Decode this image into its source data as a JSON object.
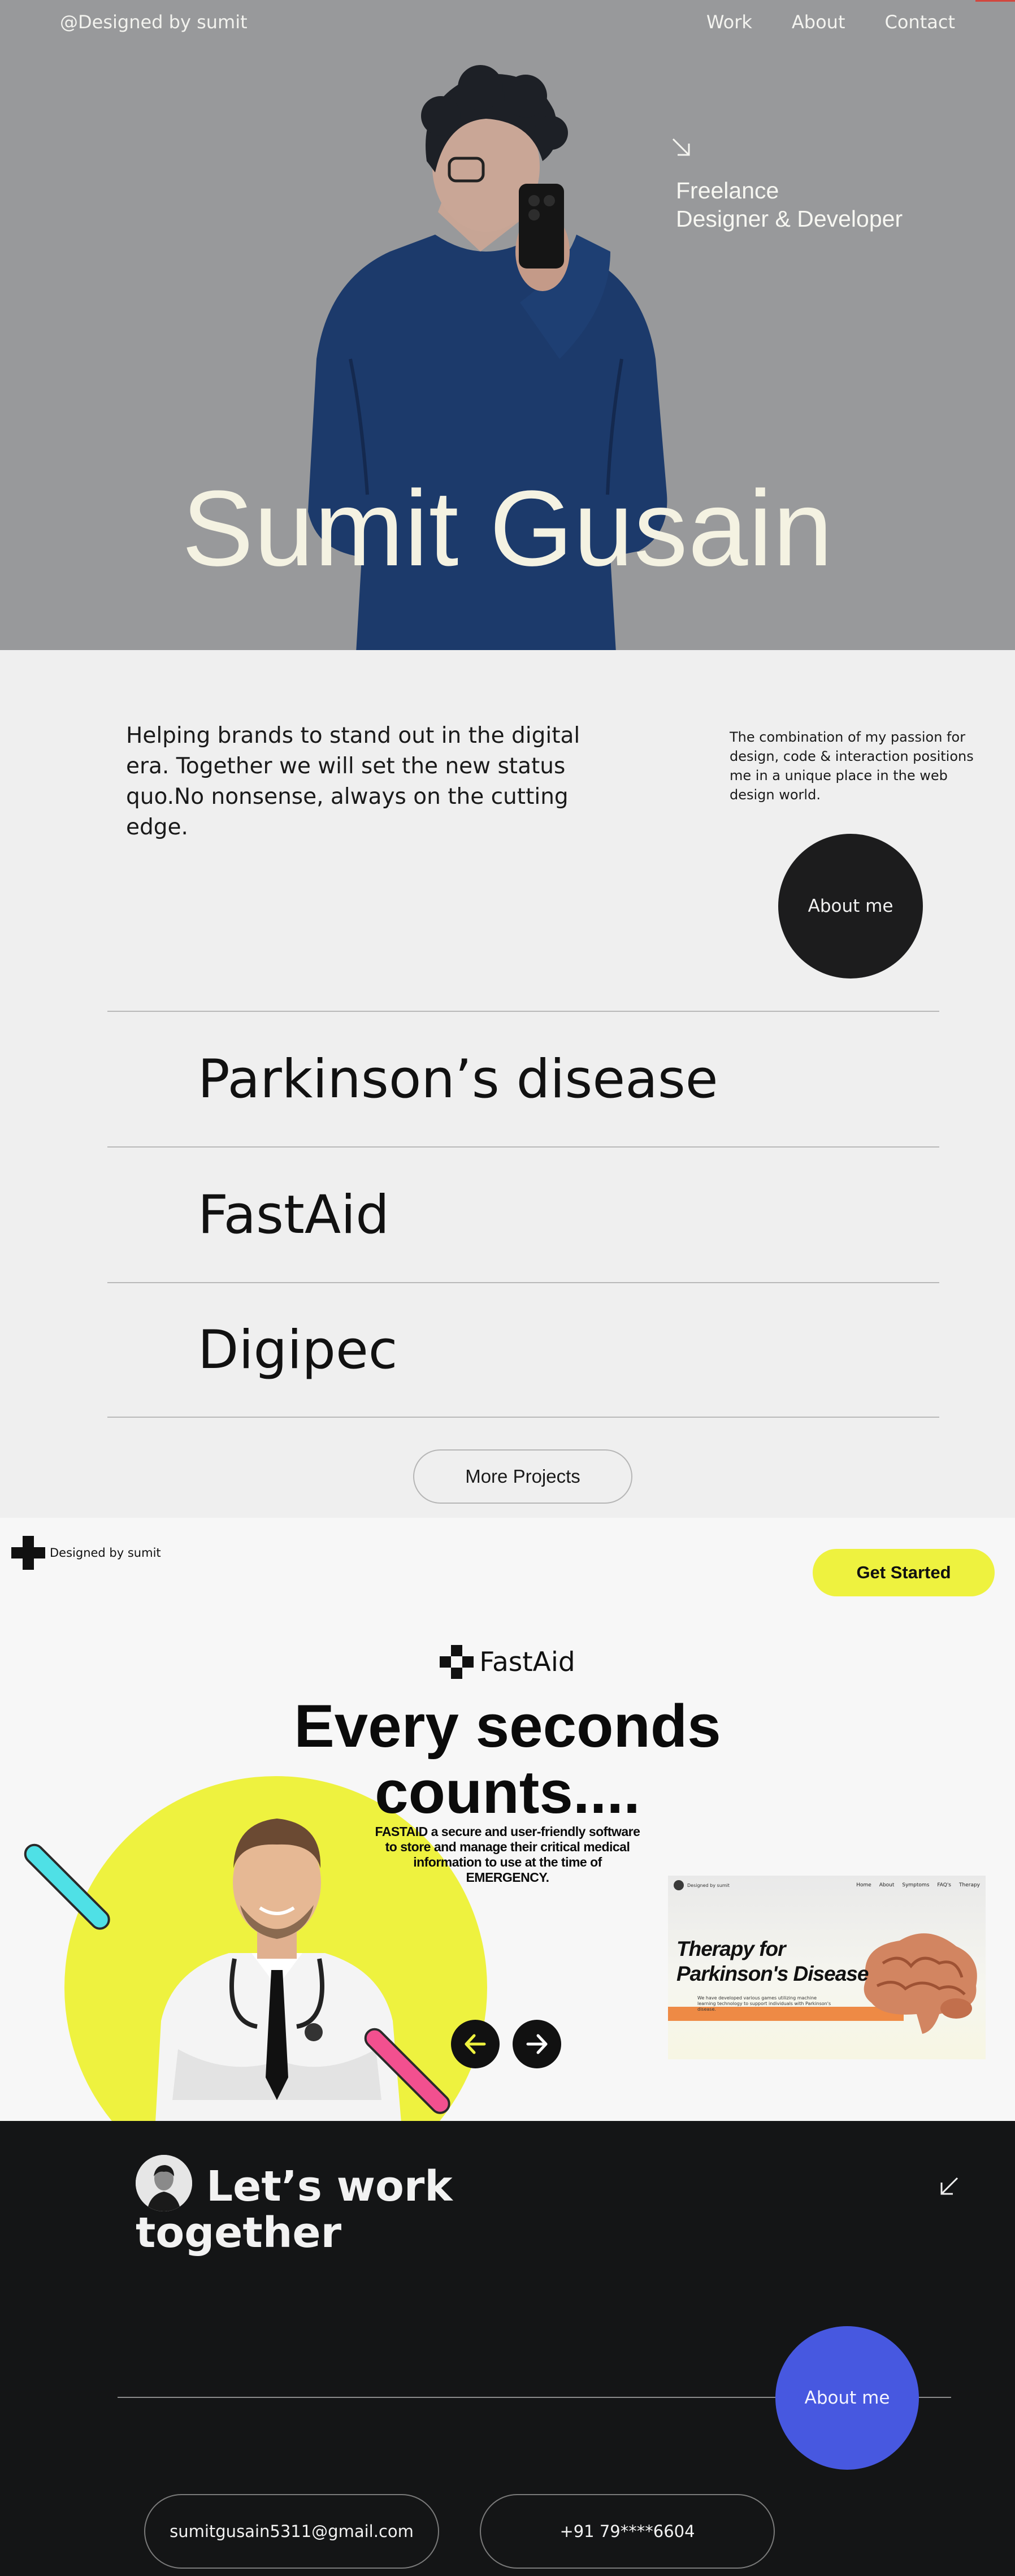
{
  "hero": {
    "brand": "@Designed by sumit",
    "nav": [
      "Work",
      "About",
      "Contact"
    ],
    "tagline_line1": "Freelance",
    "tagline_line2": "Designer & Developer",
    "name": "Sumit Gusain",
    "arrow_icon": "arrow-down-right-icon"
  },
  "intro": {
    "lead": "Helping brands to stand out in the digital era. Together we will set the new status quo.No nonsense, always on the cutting edge.",
    "side": "The combination of my passion for design, code & interaction positions me in a unique place in the web design world.",
    "about_button": "About me"
  },
  "projects": {
    "items": [
      "Parkinson’s disease",
      "FastAid",
      "Digipec"
    ],
    "more_button": "More Projects"
  },
  "showcase": {
    "logo_text": "Designed by sumit",
    "get_started": "Get Started",
    "product_name": "FastAid",
    "headline_line1": "Every seconds",
    "headline_line2": "counts....",
    "description": "FASTAID a secure and user-friendly software to store and manage their critical medical information to use at the time of EMERGENCY.",
    "preview": {
      "brand": "Designed by sumit",
      "nav": [
        "Home",
        "About",
        "Symptoms",
        "FAQ's",
        "Therapy"
      ],
      "title": "Therapy for Parkinson's Disease",
      "body": "We have developed various games utilizing machine learning technology to support individuals with Parkinson's disease."
    },
    "colors": {
      "accent_yellow": "#eef23f",
      "cyan": "#4fe0e6",
      "pink": "#f2508f",
      "preview_bar": "#ee8a45"
    }
  },
  "footer": {
    "headline_line1": "Let’s work",
    "headline_line2": "together",
    "about_button": "About me",
    "email": "sumitgusain5311@gmail.com",
    "phone": "+91 79****6604",
    "colors": {
      "background": "#141516",
      "about_blue": "#4758e0"
    }
  }
}
